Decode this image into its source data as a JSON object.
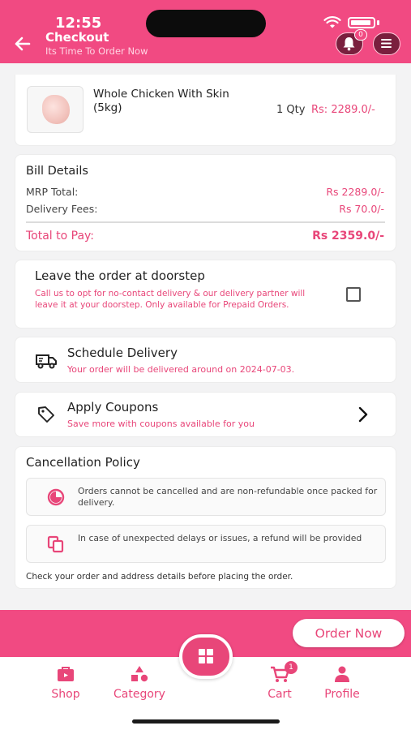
{
  "status_bar": {
    "time": "12:55"
  },
  "header": {
    "title": "Checkout",
    "subtitle": "Its Time To Order Now",
    "notification_count": "0"
  },
  "product": {
    "name": "Whole Chicken With Skin (5kg)",
    "qty": "1 Qty",
    "price": "Rs: 2289.0/-"
  },
  "bill": {
    "title": "Bill Details",
    "mrp_label": "MRP Total:",
    "mrp_value": "Rs 2289.0/-",
    "delivery_label": "Delivery Fees:",
    "delivery_value": "Rs 70.0/-",
    "total_label": "Total to Pay:",
    "total_value": "Rs 2359.0/-"
  },
  "doorstep": {
    "title": "Leave the order at doorstep",
    "description": "Call us to opt for no-contact delivery & our delivery partner will leave it at your doorstep. Only available for Prepaid Orders.",
    "checked": false
  },
  "schedule": {
    "title": "Schedule Delivery",
    "description": "Your order will be delivered around  on 2024-07-03."
  },
  "coupons": {
    "title": "Apply Coupons",
    "description": "Save more with coupons available for you"
  },
  "cancellation": {
    "title": "Cancellation Policy",
    "policies": [
      {
        "text": "Orders cannot be cancelled and are non-refundable once packed for delivery.",
        "icon": "pie-icon"
      },
      {
        "text": "In case of unexpected delays or issues, a refund will be provided",
        "icon": "copy-icon"
      }
    ],
    "footer": "Check your order and address details before placing the order."
  },
  "order_button": "Order Now",
  "nav": {
    "items": [
      {
        "label": "Shop",
        "icon": "shop-icon"
      },
      {
        "label": "Category",
        "icon": "category-icon"
      },
      {
        "label": "Cart",
        "icon": "cart-icon",
        "badge": "1"
      },
      {
        "label": "Profile",
        "icon": "profile-icon"
      }
    ],
    "center_icon": "grid-icon"
  },
  "colors": {
    "brand_pink": "#f14a82",
    "accent_text": "#e84679"
  }
}
